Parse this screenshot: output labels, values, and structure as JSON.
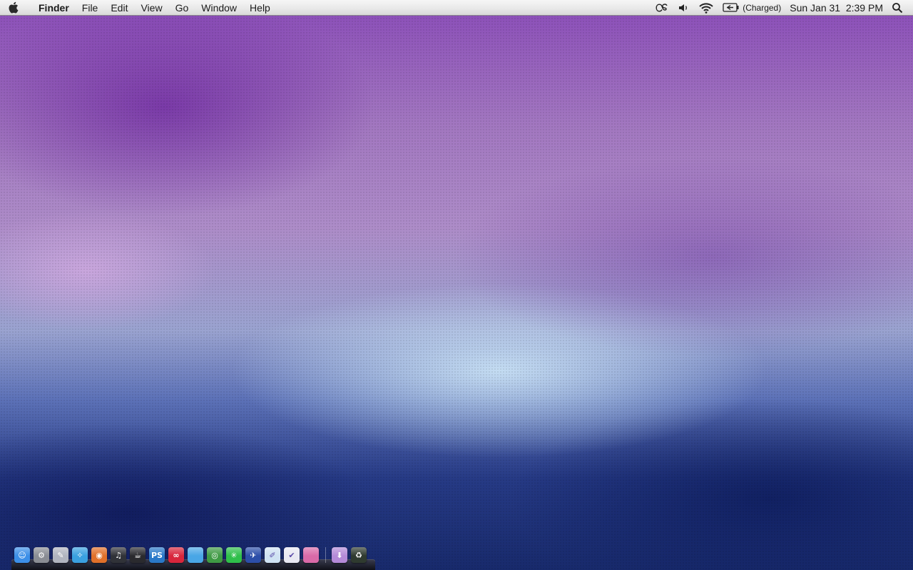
{
  "menubar": {
    "app_name": "Finder",
    "items": [
      "File",
      "Edit",
      "View",
      "Go",
      "Window",
      "Help"
    ],
    "status": {
      "lastfm_icon": "lastfm-icon",
      "volume_icon": "volume-icon",
      "wifi_icon": "wifi-icon",
      "battery_icon": "battery-icon",
      "battery_label": "(Charged)",
      "clock": "Sun Jan 31  2:39 PM",
      "spotlight_icon": "spotlight-icon"
    }
  },
  "dock": {
    "apps": [
      {
        "name": "finder-icon",
        "glyph": "☺",
        "color": "#3c8fe8"
      },
      {
        "name": "system-preferences-icon",
        "glyph": "⚙",
        "color": "#8a8d94"
      },
      {
        "name": "preview-icon",
        "glyph": "✎",
        "color": "#b0b4bf"
      },
      {
        "name": "safari-icon",
        "glyph": "✧",
        "color": "#3aa0e0"
      },
      {
        "name": "firefox-icon",
        "glyph": "◉",
        "color": "#e0702a"
      },
      {
        "name": "itunes-icon",
        "glyph": "♫",
        "color": "#303238"
      },
      {
        "name": "coffee-icon",
        "glyph": "☕",
        "color": "#2a2a2e"
      },
      {
        "name": "photoshop-icon",
        "glyph": "PS",
        "color": "#2a78c8"
      },
      {
        "name": "lastfm-app-icon",
        "glyph": "∞",
        "color": "#d8263c"
      },
      {
        "name": "app-blue-icon",
        "glyph": "",
        "color": "#49a6e6"
      },
      {
        "name": "chrome-icon",
        "glyph": "◎",
        "color": "#3f9a44"
      },
      {
        "name": "xcode-green-icon",
        "glyph": "✳",
        "color": "#2fbf4a"
      },
      {
        "name": "bird-icon",
        "glyph": "✈",
        "color": "#2c4ea8"
      },
      {
        "name": "textedit-icon",
        "glyph": "✐",
        "color": "#cfe2f3"
      },
      {
        "name": "checkmark-icon",
        "glyph": "✔",
        "color": "#e8e8f2"
      },
      {
        "name": "photo-icon",
        "glyph": "",
        "color": "#d96aa8"
      }
    ],
    "right": [
      {
        "name": "downloads-icon",
        "glyph": "⬇",
        "color": "#b48ad8"
      },
      {
        "name": "trash-icon",
        "glyph": "♻",
        "color": "#2f3a2f"
      }
    ]
  }
}
